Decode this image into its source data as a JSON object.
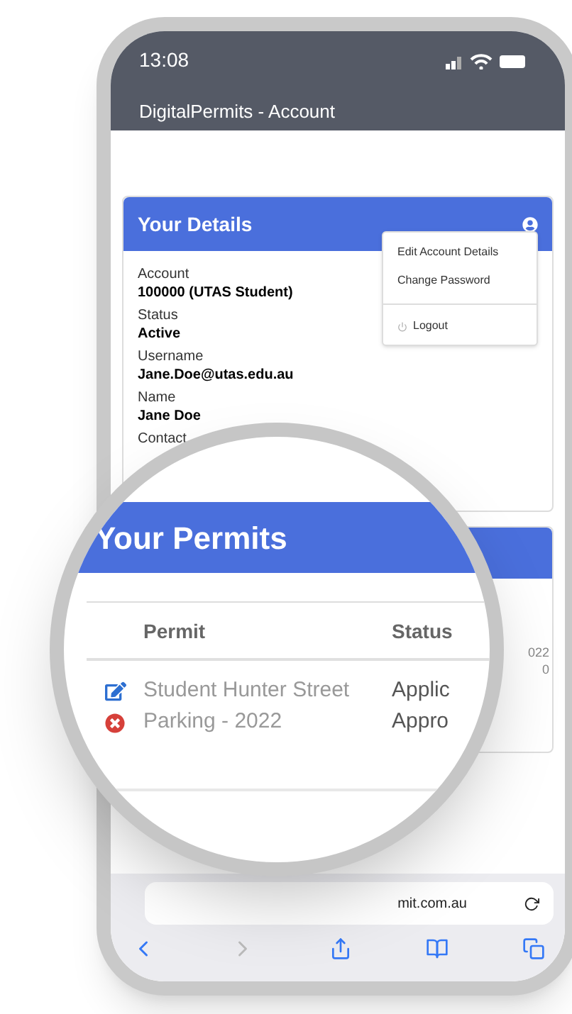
{
  "status_bar": {
    "time": "13:08"
  },
  "header": {
    "title": "DigitalPermits - Account"
  },
  "details_card": {
    "title": "Your Details",
    "fields": [
      {
        "label": "Account",
        "value": "100000 (UTAS Student)"
      },
      {
        "label": "Status",
        "value": "Active"
      },
      {
        "label": "Username",
        "value": "Jane.Doe@utas.edu.au"
      },
      {
        "label": "Name",
        "value": "Jane Doe"
      }
    ],
    "partial_label": "Contact",
    "menu": {
      "expanded": true,
      "items": [
        {
          "label": "Edit Account Details",
          "kind": "plain"
        },
        {
          "label": "Change Password",
          "kind": "plain"
        },
        {
          "label": "Logout",
          "kind": "logout"
        }
      ]
    }
  },
  "permits_card_behind": {
    "fragments": [
      "022",
      "0"
    ]
  },
  "magnifier": {
    "title": "Your Permits",
    "columns": [
      "Permit",
      "Status"
    ],
    "rows": [
      {
        "permit": "Student Hunter Street Parking - 2022",
        "status": [
          "Applic",
          "Appro"
        ]
      }
    ]
  },
  "browser": {
    "url": "mit.com.au"
  }
}
